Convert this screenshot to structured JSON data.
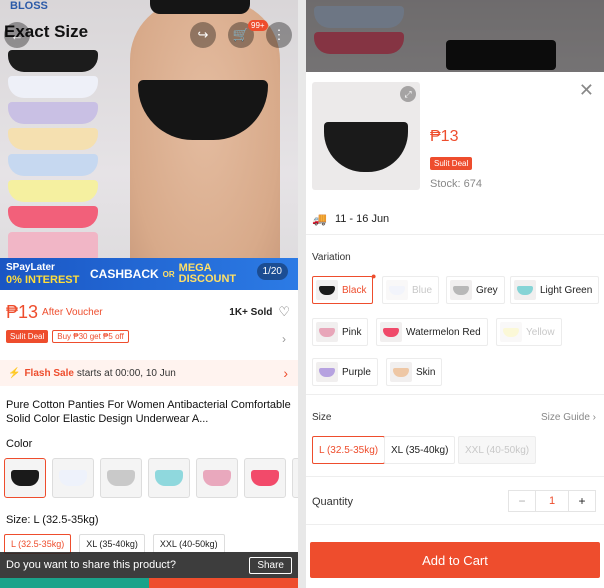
{
  "left": {
    "brand": "BLOSS",
    "hero_caption": "Exact Size",
    "cart_badge": "99+",
    "promo": {
      "spaylater": "SPayLater",
      "interest": "0% INTEREST",
      "cashback": "CASHBACK",
      "or": "OR",
      "mega": "MEGA",
      "discount": "DISCOUNT"
    },
    "pager": "1/20",
    "price": "₱13",
    "after_voucher": "After Voucher",
    "sold": "1K+ Sold",
    "tags": {
      "deal": "Sulit Deal",
      "voucher": "Buy ₱30 get ₱5 off"
    },
    "flash": {
      "label": "Flash Sale",
      "text": "starts at 00:00, 10 Jun"
    },
    "title": "Pure Cotton Panties For Women Antibacterial Comfortable Solid Color Elastic Design Underwear A...",
    "color_label": "Color",
    "thumb_colors": [
      "#1a1a1a",
      "#eef2fb",
      "#c9c9c9",
      "#8fd8dd",
      "#e9a8bd",
      "#f24a6a",
      "#f2c9a7"
    ],
    "size_label": "Size: L (32.5-35kg)",
    "sizes": [
      "L (32.5-35kg)",
      "XL (35-40kg)",
      "XXL (40-50kg)"
    ],
    "share_prompt": "Do you want to share this product?",
    "share_button": "Share"
  },
  "right": {
    "price": "₱13",
    "deal_tag": "Sulit Deal",
    "stock": "Stock: 674",
    "shipping": "11 - 16 Jun",
    "variation_label": "Variation",
    "colors": [
      {
        "label": "Black",
        "sw": "#1a1a1a",
        "state": "selected"
      },
      {
        "label": "Blue",
        "sw": "#dfe6f7",
        "state": "disabled"
      },
      {
        "label": "Grey",
        "sw": "#b8b8b8",
        "state": "normal"
      },
      {
        "label": "Light Green",
        "sw": "#86d4d6",
        "state": "normal"
      },
      {
        "label": "Pink",
        "sw": "#e8a6b9",
        "state": "normal"
      },
      {
        "label": "Watermelon Red",
        "sw": "#f04a6a",
        "state": "normal"
      },
      {
        "label": "Yellow",
        "sw": "#f6ef9e",
        "state": "disabled"
      },
      {
        "label": "Purple",
        "sw": "#b6a2e0",
        "state": "normal"
      },
      {
        "label": "Skin",
        "sw": "#eec7a5",
        "state": "normal"
      }
    ],
    "size_label": "Size",
    "size_guide": "Size Guide",
    "sizes": [
      {
        "label": "L (32.5-35kg)",
        "state": "selected"
      },
      {
        "label": "XL (35-40kg)",
        "state": "normal"
      },
      {
        "label": "XXL (40-50kg)",
        "state": "disabled"
      }
    ],
    "quantity_label": "Quantity",
    "quantity": "1",
    "minus": "−",
    "plus": "+",
    "add_to_cart": "Add to Cart"
  },
  "accent": "#ee4d2d"
}
